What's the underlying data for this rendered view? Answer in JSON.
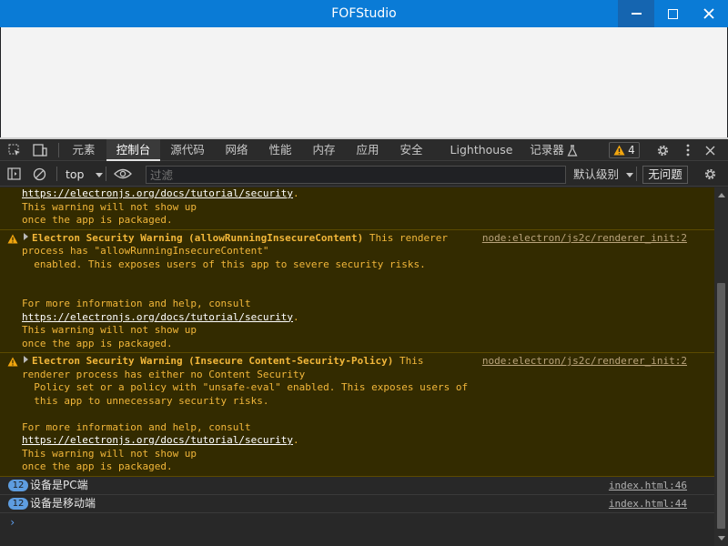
{
  "window": {
    "title": "FOFStudio"
  },
  "devtools": {
    "tabs": [
      "元素",
      "控制台",
      "源代码",
      "网络",
      "性能",
      "内存",
      "应用",
      "安全",
      "Lighthouse",
      "记录器"
    ],
    "warning_count": "4"
  },
  "toolbar": {
    "context": "top",
    "filter_placeholder": "过滤",
    "log_level": "默认级别",
    "issues": "无问题"
  },
  "console": {
    "warn0": {
      "link": "https://electronjs.org/docs/tutorial/security",
      "line2": "This warning will not show up",
      "line3": "once the app is packaged."
    },
    "warn1": {
      "title": "Electron Security Warning (allowRunningInsecureContent)",
      "text_a": " This renderer",
      "text_b": "process has \"allowRunningInsecureContent\"",
      "text_c": "  enabled. This exposes users of this app to severe security risks.",
      "help": "For more information and help, consult",
      "link": "https://electronjs.org/docs/tutorial/security",
      "line2": "This warning will not show up",
      "line3": "once the app is packaged.",
      "source": "node:electron/js2c/renderer_init:2"
    },
    "warn2": {
      "title": "Electron Security Warning (Insecure Content-Security-Policy)",
      "text_a": " This",
      "text_b": "renderer process has either no Content Security",
      "text_c": "  Policy set or a policy with \"unsafe-eval\" enabled. This exposes users of",
      "text_d": "  this app to unnecessary security risks.",
      "help": "For more information and help, consult",
      "link": "https://electronjs.org/docs/tutorial/security",
      "line2": "This warning will not show up",
      "line3": "once the app is packaged.",
      "source": "node:electron/js2c/renderer_init:2"
    },
    "log1": {
      "count": "12",
      "text": "设备是PC端",
      "source": "index.html:46"
    },
    "log2": {
      "count": "12",
      "text": "设备是移动端",
      "source": "index.html:44"
    },
    "prompt": "›"
  },
  "colors": {
    "titlebar": "#0a7bd6",
    "warning_bg": "#332b00",
    "warning_text": "#f2b73a"
  }
}
